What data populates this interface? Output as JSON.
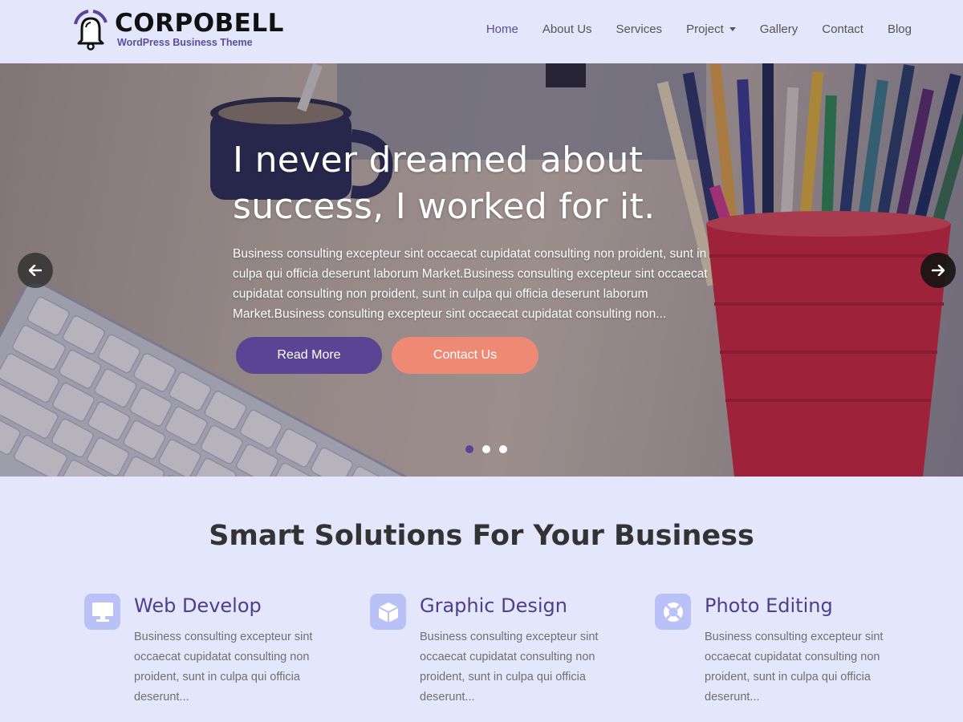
{
  "header": {
    "logo_name": "CORPOBELL",
    "logo_tagline": "WordPress Business Theme",
    "nav": [
      {
        "label": "Home",
        "active": true
      },
      {
        "label": "About Us"
      },
      {
        "label": "Services"
      },
      {
        "label": "Project",
        "has_dropdown": true
      },
      {
        "label": "Gallery"
      },
      {
        "label": "Contact"
      },
      {
        "label": "Blog"
      }
    ]
  },
  "hero": {
    "title_line1": "I never dreamed about",
    "title_line2": "success, I worked for it.",
    "text": "Business consulting excepteur sint occaecat cupidatat consulting non proident, sunt in culpa qui officia deserunt laborum Market.Business consulting excepteur sint occaecat cupidatat consulting non proident, sunt in culpa qui officia deserunt laborum Market.Business consulting excepteur sint occaecat cupidatat consulting non...",
    "read_more_label": "Read More",
    "contact_label": "Contact Us",
    "prev_icon": "arrow-left-icon",
    "next_icon": "arrow-right-icon",
    "slides_total": 3,
    "active_slide": 1
  },
  "solutions": {
    "title": "Smart Solutions For Your Business",
    "services": [
      {
        "icon": "monitor-icon",
        "title": "Web Develop",
        "text": "Business consulting excepteur sint occaecat cupidatat consulting non proident, sunt in culpa qui officia deserunt..."
      },
      {
        "icon": "cube-icon",
        "title": "Graphic Design",
        "text": "Business consulting excepteur sint occaecat cupidatat consulting non proident, sunt in culpa qui officia deserunt..."
      },
      {
        "icon": "lifebuoy-icon",
        "title": "Photo Editing",
        "text": "Business consulting excepteur sint occaecat cupidatat consulting non proident, sunt in culpa qui officia deserunt..."
      }
    ]
  },
  "colors": {
    "page_bg": "#e4e6fc",
    "accent_purple": "#5a4493",
    "accent_coral": "#ee8a73",
    "service_title": "#4f3f8a",
    "icon_bg": "#b9c1f6"
  }
}
